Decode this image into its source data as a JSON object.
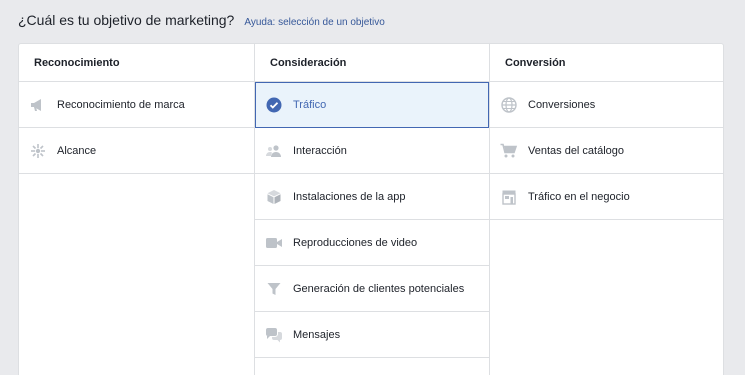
{
  "header": {
    "title": "¿Cuál es tu objetivo de marketing?",
    "help_link": "Ayuda: selección de un objetivo"
  },
  "columns": [
    {
      "heading": "Reconocimiento",
      "items": [
        {
          "label": "Reconocimiento de marca",
          "icon": "megaphone-icon"
        },
        {
          "label": "Alcance",
          "icon": "reach-icon"
        }
      ]
    },
    {
      "heading": "Consideración",
      "items": [
        {
          "label": "Tráfico",
          "icon": "check-circle-icon",
          "selected": true
        },
        {
          "label": "Interacción",
          "icon": "people-icon"
        },
        {
          "label": "Instalaciones de la app",
          "icon": "box-icon"
        },
        {
          "label": "Reproducciones de video",
          "icon": "video-camera-icon"
        },
        {
          "label": "Generación de clientes potenciales",
          "icon": "funnel-icon"
        },
        {
          "label": "Mensajes",
          "icon": "chat-bubbles-icon"
        }
      ]
    },
    {
      "heading": "Conversión",
      "items": [
        {
          "label": "Conversiones",
          "icon": "globe-icon"
        },
        {
          "label": "Ventas del catálogo",
          "icon": "shopping-cart-icon"
        },
        {
          "label": "Tráfico en el negocio",
          "icon": "store-icon"
        }
      ]
    }
  ],
  "colors": {
    "accent": "#4267b2",
    "selected_bg": "#eaf3fb",
    "icon_gray": "#bec3c9",
    "border": "#dddfe2"
  }
}
